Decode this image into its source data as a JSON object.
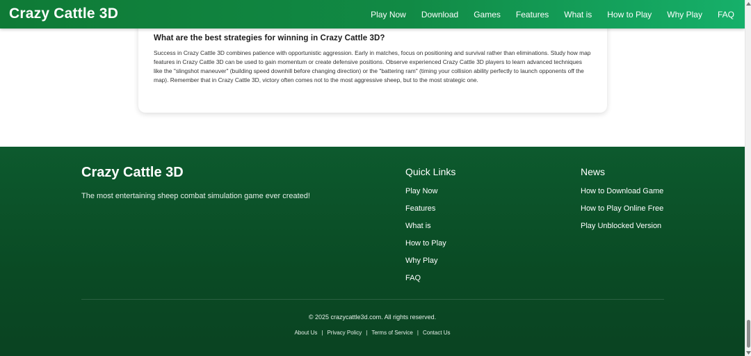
{
  "header": {
    "logo": "Crazy Cattle 3D",
    "nav": [
      "Play Now",
      "Download",
      "Games",
      "Features",
      "What is",
      "How to Play",
      "Why Play",
      "FAQ"
    ]
  },
  "faq": {
    "question": "What are the best strategies for winning in Crazy Cattle 3D?",
    "answer": "Success in Crazy Cattle 3D combines patience with opportunistic aggression. Early in matches, focus on positioning and survival rather than eliminations. Study how map features in Crazy Cattle 3D can be used to gain momentum or create defensive positions. Observe experienced Crazy Cattle 3D players to learn advanced techniques like the \"slingshot maneuver\" (building speed downhill before changing direction) or the \"battering ram\" (timing your collision ability perfectly to launch opponents off the map). Remember that in Crazy Cattle 3D, victory often comes not to the most aggressive sheep, but to the most strategic one."
  },
  "footer": {
    "brand": "Crazy Cattle 3D",
    "tagline": "The most entertaining sheep combat simulation game ever created!",
    "quick_links": {
      "title": "Quick Links",
      "items": [
        "Play Now",
        "Features",
        "What is",
        "How to Play",
        "Why Play",
        "FAQ"
      ]
    },
    "news": {
      "title": "News",
      "items": [
        "How to Download Game",
        "How to Play Online Free",
        "Play Unblocked Version"
      ]
    },
    "copyright": "© 2025 crazycattle3d.com. All rights reserved.",
    "legal": [
      "About Us",
      "Privacy Policy",
      "Terms of Service",
      "Contact Us"
    ],
    "separator": "|"
  },
  "colors": {
    "header_start": "#0f7a36",
    "header_end": "#16b06a",
    "footer_bg": "#0a4a24",
    "text_white": "#ffffff"
  },
  "icons": {
    "scroll_up": "triangle-up-icon",
    "scroll_down": "triangle-down-icon"
  }
}
